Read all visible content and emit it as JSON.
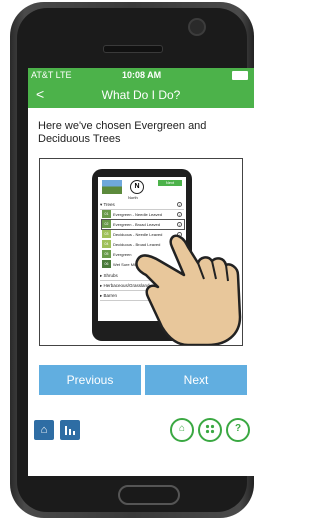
{
  "status_bar": {
    "carrier": "AT&T LTE",
    "time": "10:08 AM"
  },
  "header": {
    "back_icon": "chevron-left-icon",
    "title": "What Do I Do?"
  },
  "intro_text": "Here we've chosen Evergreen and Deciduous Trees",
  "tutorial_image": {
    "compass_letter": "N",
    "compass_label": "North",
    "next_label": "Next",
    "categories": [
      "Trees",
      "Shrubs",
      "Herbaceous/Grassland",
      "Barren"
    ],
    "tree_items": [
      {
        "code": "01",
        "label": "Evergreen - Needle Leaved"
      },
      {
        "code": "02",
        "label": "Evergreen - Broad Leaved"
      },
      {
        "code": "03",
        "label": "Deciduous - Needle Leaved"
      },
      {
        "code": "04",
        "label": "Deciduous - Broad Leaved"
      },
      {
        "code": "05",
        "label": "Evergreen"
      },
      {
        "code": "06",
        "label": "Wet Sure Mixed"
      }
    ]
  },
  "buttons": {
    "previous": "Previous",
    "next": "Next"
  },
  "toolbar": {
    "left": [
      "home-icon",
      "bar-chart-icon"
    ],
    "right": [
      "home-icon",
      "grid-icon",
      "help-icon"
    ],
    "help_glyph": "?",
    "accent_green": "#3aa842",
    "accent_blue": "#2e6da4"
  },
  "colors": {
    "header_green": "#4cb24a",
    "button_blue": "#61aee0"
  }
}
